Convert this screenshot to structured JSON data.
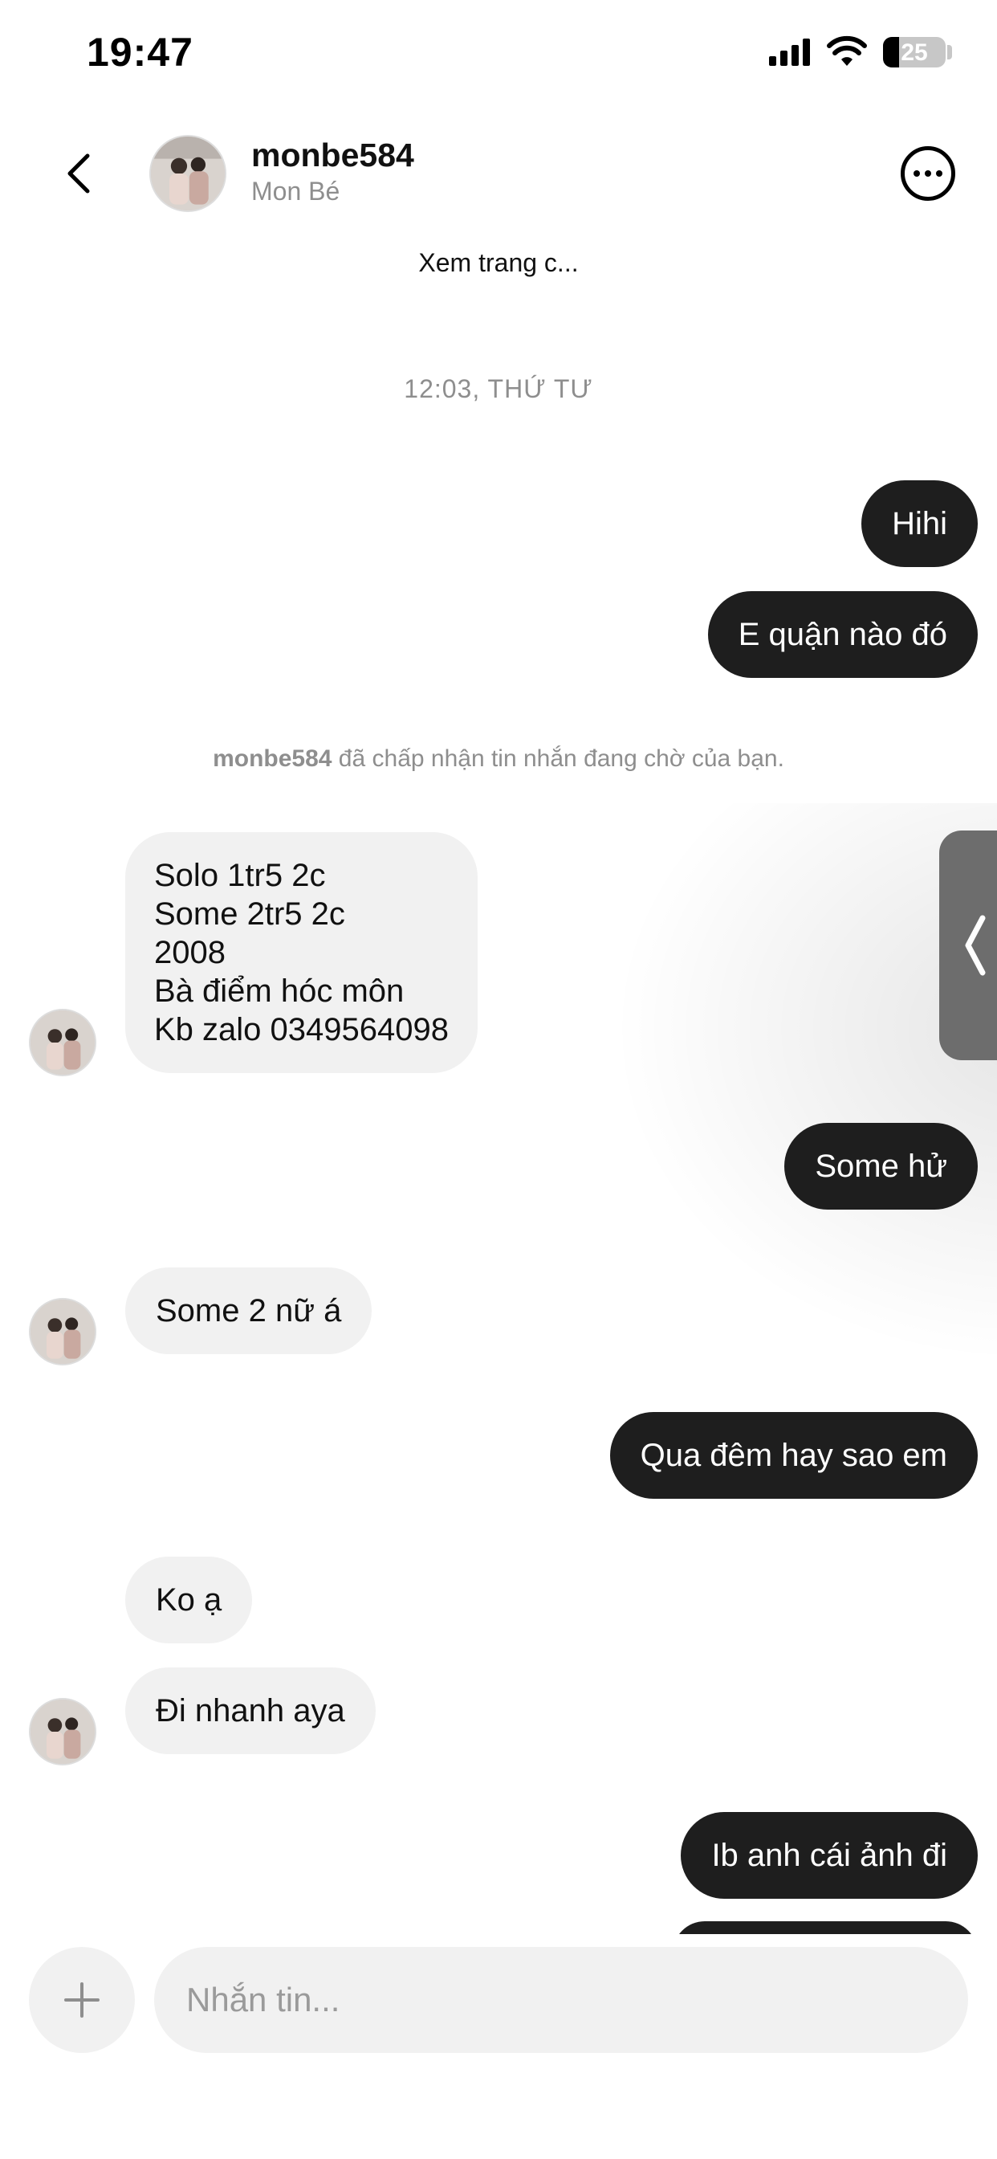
{
  "status_bar": {
    "time": "19:47",
    "battery": "25",
    "battery_level": 0.25
  },
  "header": {
    "username": "monbe584",
    "fullname": "Mon Bé",
    "view_profile": "Xem trang c..."
  },
  "conversation": {
    "timestamp": "12:03, THỨ TƯ",
    "system_note_user": "monbe584",
    "system_note_text": " đã chấp nhận tin nhắn đang chờ của bạn.",
    "messages": [
      {
        "from": "me",
        "text": "Hihi"
      },
      {
        "from": "me",
        "text": "E quận nào đó"
      },
      {
        "from": "them",
        "text": "Solo 1tr5 2c\nSome 2tr5 2c\n2008\nBà điểm hóc môn\nKb zalo 0349564098"
      },
      {
        "from": "me",
        "text": "Some hử"
      },
      {
        "from": "them",
        "text": "Some 2 nữ á"
      },
      {
        "from": "me",
        "text": "Qua đêm hay sao em"
      },
      {
        "from": "them",
        "text": "Ko ạ"
      },
      {
        "from": "them",
        "text": "Đi nhanh aya"
      },
      {
        "from": "me",
        "text": "Ib anh cái ảnh đi"
      }
    ]
  },
  "composer": {
    "placeholder": "Nhắn tin..."
  }
}
